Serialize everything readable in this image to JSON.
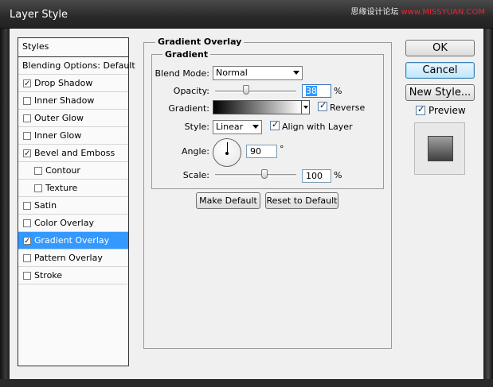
{
  "window": {
    "title": "Layer Style",
    "watermark_prefix": "思缘设计论坛 ",
    "watermark_site": "www.MISSYUAN.COM"
  },
  "styles_list": {
    "header": "Styles",
    "items": [
      {
        "label": "Blending Options: Default",
        "has_checkbox": false,
        "checked": false,
        "indent": false,
        "selected": false
      },
      {
        "label": "Drop Shadow",
        "has_checkbox": true,
        "checked": true,
        "indent": false,
        "selected": false
      },
      {
        "label": "Inner Shadow",
        "has_checkbox": true,
        "checked": false,
        "indent": false,
        "selected": false
      },
      {
        "label": "Outer Glow",
        "has_checkbox": true,
        "checked": false,
        "indent": false,
        "selected": false
      },
      {
        "label": "Inner Glow",
        "has_checkbox": true,
        "checked": false,
        "indent": false,
        "selected": false
      },
      {
        "label": "Bevel and Emboss",
        "has_checkbox": true,
        "checked": true,
        "indent": false,
        "selected": false
      },
      {
        "label": "Contour",
        "has_checkbox": true,
        "checked": false,
        "indent": true,
        "selected": false
      },
      {
        "label": "Texture",
        "has_checkbox": true,
        "checked": false,
        "indent": true,
        "selected": false
      },
      {
        "label": "Satin",
        "has_checkbox": true,
        "checked": false,
        "indent": false,
        "selected": false
      },
      {
        "label": "Color Overlay",
        "has_checkbox": true,
        "checked": false,
        "indent": false,
        "selected": false
      },
      {
        "label": "Gradient Overlay",
        "has_checkbox": true,
        "checked": true,
        "indent": false,
        "selected": true
      },
      {
        "label": "Pattern Overlay",
        "has_checkbox": true,
        "checked": false,
        "indent": false,
        "selected": false
      },
      {
        "label": "Stroke",
        "has_checkbox": true,
        "checked": false,
        "indent": false,
        "selected": false
      }
    ]
  },
  "gradient_overlay": {
    "section_title": "Gradient Overlay",
    "group_title": "Gradient",
    "blend_mode_label": "Blend Mode:",
    "blend_mode_value": "Normal",
    "opacity_label": "Opacity:",
    "opacity_value": "38",
    "opacity_unit": "%",
    "opacity_level": 0.38,
    "gradient_label": "Gradient:",
    "reverse_label": "Reverse",
    "reverse_checked": true,
    "style_label": "Style:",
    "style_value": "Linear",
    "align_label": "Align with Layer",
    "align_checked": true,
    "angle_label": "Angle:",
    "angle_value": "90",
    "angle_unit": "°",
    "scale_label": "Scale:",
    "scale_value": "100",
    "scale_unit": "%",
    "make_default_label": "Make Default",
    "reset_default_label": "Reset to Default"
  },
  "buttons": {
    "ok": "OK",
    "cancel": "Cancel",
    "new_style": "New Style...",
    "preview_label": "Preview",
    "preview_checked": true
  },
  "colors": {
    "selection": "#3399ff",
    "dialog_bg": "#f0f0f0",
    "titlebar": "#2a2a2a"
  }
}
